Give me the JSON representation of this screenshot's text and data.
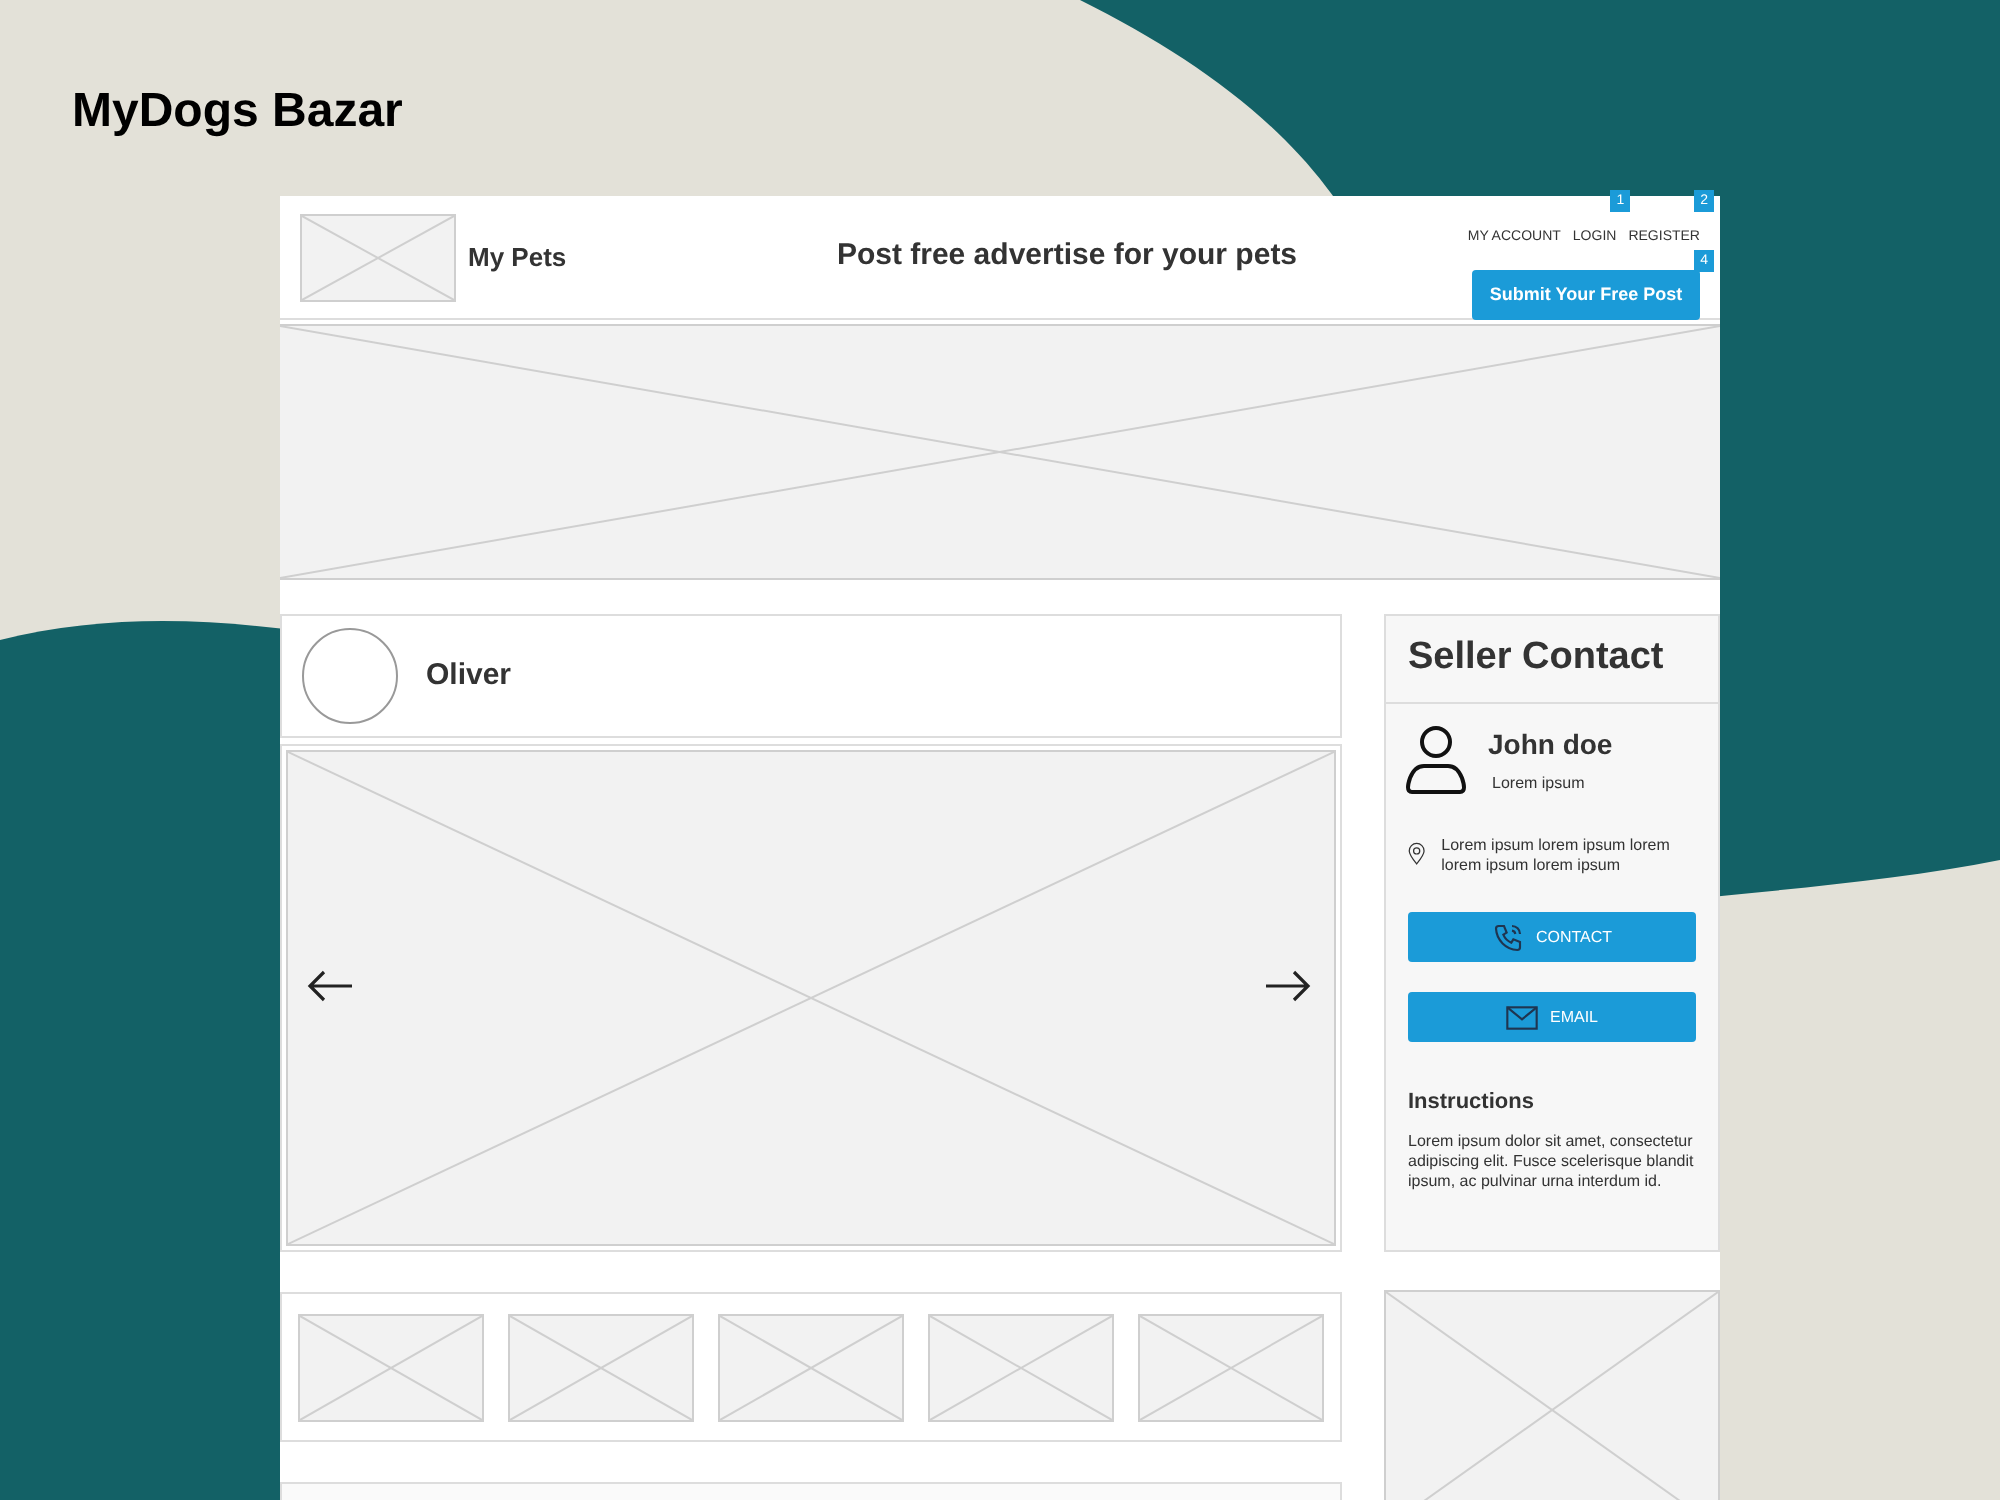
{
  "page_title": "MyDogs Bazar",
  "header": {
    "brand": "My Pets",
    "tagline": "Post free advertise for your pets",
    "links": [
      {
        "label": "MY ACCOUNT"
      },
      {
        "label": "LOGIN",
        "badge": "1"
      },
      {
        "label": "REGISTER",
        "badge": "2"
      }
    ],
    "submit_button": {
      "label": "Submit Your Free Post",
      "badge": "4"
    }
  },
  "profile": {
    "name": "Oliver"
  },
  "seller_contact": {
    "title": "Seller Contact",
    "name": "John doe",
    "subtitle": "Lorem ipsum",
    "address": "Lorem ipsum lorem ipsum lorem lorem ipsum lorem ipsum",
    "buttons": [
      {
        "kind": "phone",
        "label": "CONTACT"
      },
      {
        "kind": "mail",
        "label": "EMAIL"
      }
    ],
    "instructions_title": "Instructions",
    "instructions": "Lorem ipsum dolor sit amet, consectetur adipiscing elit. Fusce scelerisque blandit ipsum, ac pulvinar urna interdum id."
  }
}
